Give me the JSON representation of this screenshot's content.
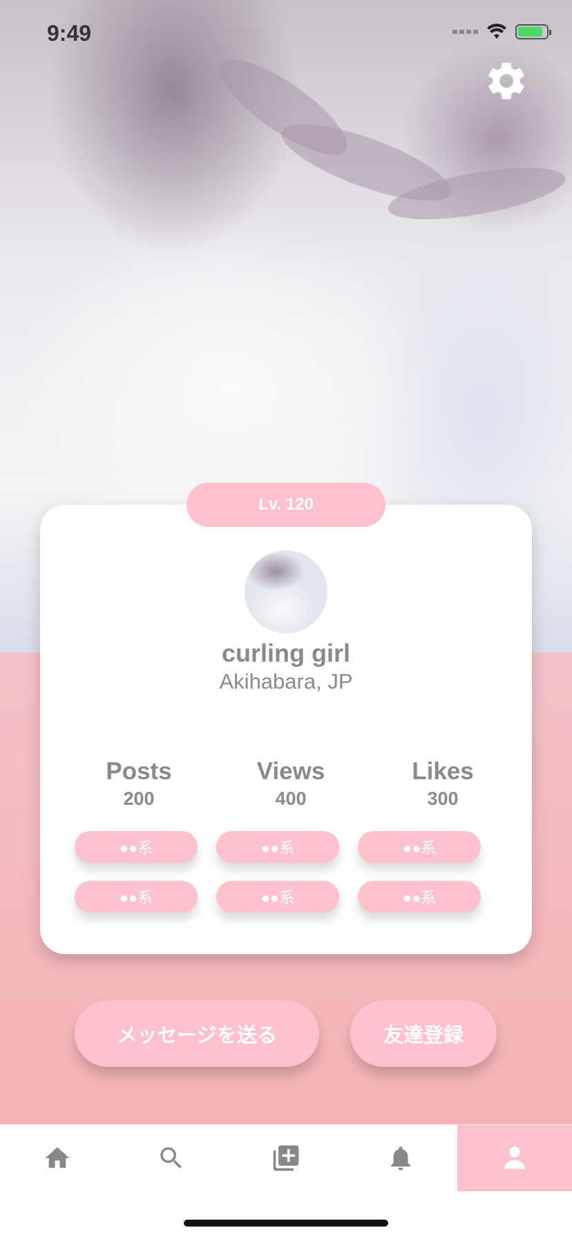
{
  "status_bar": {
    "time": "9:49"
  },
  "profile": {
    "level": "Lv. 120",
    "name": "curling girl",
    "location": "Akihabara, JP"
  },
  "stats": [
    {
      "label": "Posts",
      "value": "200"
    },
    {
      "label": "Views",
      "value": "400"
    },
    {
      "label": "Likes",
      "value": "300"
    }
  ],
  "tags": [
    "●●系",
    "●●系",
    "●●系",
    "●●系",
    "●●系",
    "●●系"
  ],
  "buttons": {
    "message": "メッセージを送る",
    "friend": "友達登録"
  },
  "tabbar": {
    "items": [
      {
        "icon": "home-icon",
        "active": false
      },
      {
        "icon": "search-icon",
        "active": false
      },
      {
        "icon": "add-post-icon",
        "active": false
      },
      {
        "icon": "bell-icon",
        "active": false
      },
      {
        "icon": "profile-icon",
        "active": true
      }
    ]
  },
  "colors": {
    "accent": "#ffc1cc",
    "background_pink": "#f5b3b5",
    "text_gray": "#8a8a8a"
  }
}
